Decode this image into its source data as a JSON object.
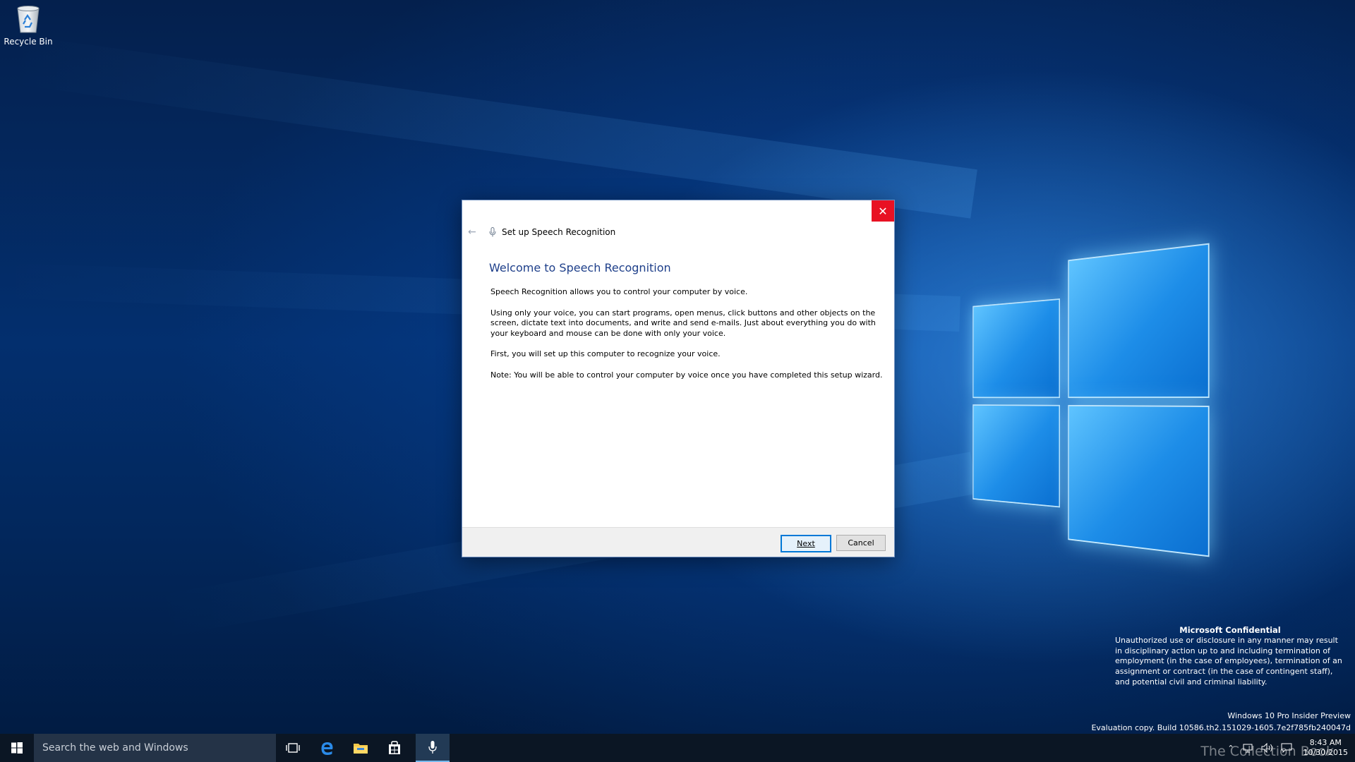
{
  "desktop": {
    "recycle_bin_label": "Recycle Bin"
  },
  "dialog": {
    "window_title": "Set up Speech Recognition",
    "heading": "Welcome to Speech Recognition",
    "paragraphs": [
      "Speech Recognition allows you to control your computer by voice.",
      "Using only your voice, you can start programs, open menus, click buttons and other objects on the screen, dictate text into documents, and write and send e-mails. Just about everything you do with your keyboard and mouse can be done with only your voice.",
      "First, you will set up this computer to recognize your voice.",
      "Note: You will be able to control your computer by voice once you have completed this setup wizard."
    ],
    "next_label": "Next",
    "cancel_label": "Cancel",
    "close_glyph": "✕",
    "back_glyph": "←"
  },
  "watermark": {
    "title": "Microsoft Confidential",
    "text": "Unauthorized use or disclosure in any manner may result in disciplinary action up to and including termination of employment (in the case of employees), termination of an assignment or contract (in the case of contingent staff), and potential civil and criminal liability.",
    "edition": "Windows 10 Pro Insider Preview",
    "build": "Evaluation copy. Build 10586.th2.151029-1605.7e2f785fb240047d",
    "overlay_text": "The Collection Book"
  },
  "taskbar": {
    "search_placeholder": "Search the web and Windows",
    "time": "8:43 AM",
    "date": "10/30/2015",
    "icons": [
      "windows-start-icon",
      "task-view-icon",
      "edge-icon",
      "file-explorer-icon",
      "store-icon",
      "microphone-icon"
    ]
  },
  "colors": {
    "close_red": "#e81123",
    "heading_blue": "#1e3f8a",
    "taskbar": "#0b1624",
    "accent": "#0078d7"
  }
}
